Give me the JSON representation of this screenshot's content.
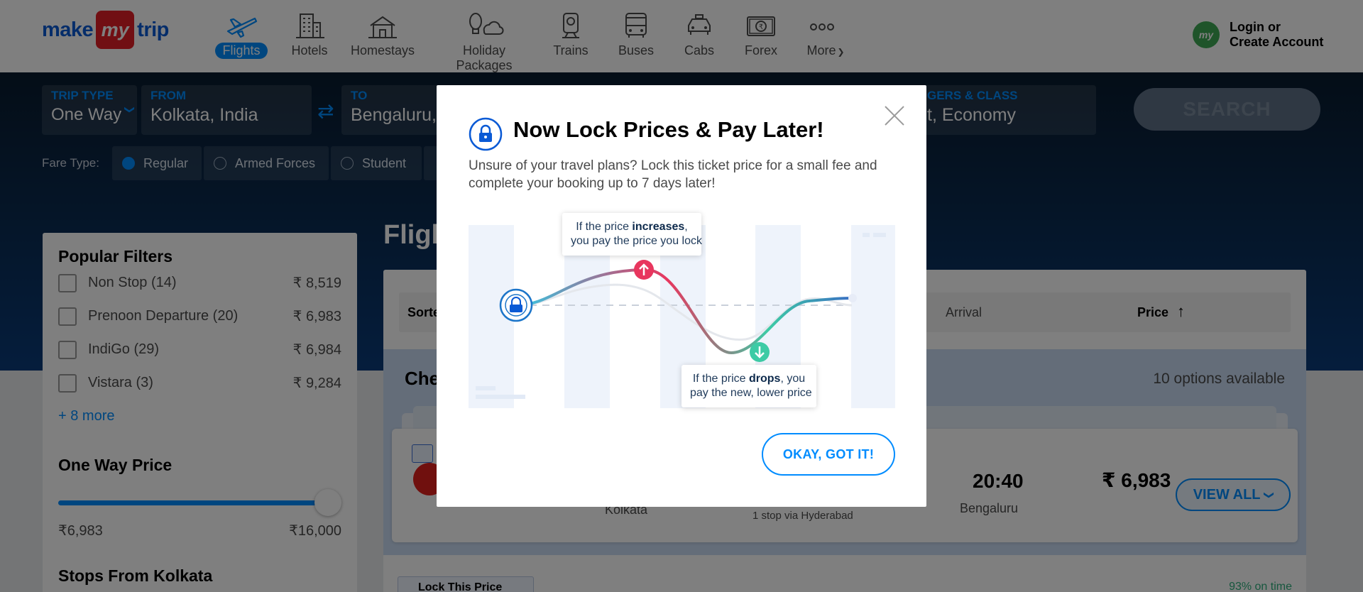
{
  "header": {
    "logo": {
      "part1": "make",
      "part2": "my",
      "part3": "trip"
    },
    "nav": [
      {
        "label": "Flights",
        "icon": "plane-icon",
        "active": true
      },
      {
        "label": "Hotels",
        "icon": "hotel-icon",
        "active": false
      },
      {
        "label": "Homestays",
        "icon": "homestay-icon",
        "active": false
      },
      {
        "label": "Holiday Packages",
        "icon": "holiday-icon",
        "active": false
      },
      {
        "label": "Trains",
        "icon": "train-icon",
        "active": false
      },
      {
        "label": "Buses",
        "icon": "bus-icon",
        "active": false
      },
      {
        "label": "Cabs",
        "icon": "cab-icon",
        "active": false
      },
      {
        "label": "Forex",
        "icon": "forex-icon",
        "active": false
      },
      {
        "label": "More",
        "icon": "more-icon",
        "active": false
      }
    ],
    "avatar_text": "my",
    "login_line1": "Login or",
    "login_line2": "Create Account"
  },
  "search": {
    "trip_type_label": "TRIP TYPE",
    "trip_type_value": "One Way",
    "from_label": "FROM",
    "from_value": "Kolkata, India",
    "to_label": "TO",
    "to_value": "Bengaluru,",
    "pax_label": "GERS & CLASS",
    "pax_value": "t, Economy",
    "search_label": "SEARCH",
    "fare_type_label": "Fare Type:",
    "fare_types": [
      "Regular",
      "Armed Forces",
      "Student"
    ]
  },
  "filters": {
    "popular_title": "Popular Filters",
    "items": [
      {
        "label": "Non Stop (14)",
        "price": "₹ 8,519"
      },
      {
        "label": "Prenoon Departure (20)",
        "price": "₹ 6,983"
      },
      {
        "label": "IndiGo (29)",
        "price": "₹ 6,984"
      },
      {
        "label": "Vistara (3)",
        "price": "₹ 9,284"
      }
    ],
    "more_label": "+ 8 more",
    "price_title": "One Way Price",
    "price_min": "₹6,983",
    "price_max": "₹16,000",
    "price_slider_fraction": 1.0,
    "stops_title": "Stops From Kolkata"
  },
  "results": {
    "flights_heading": "Fligh",
    "sort_label": "Sorte",
    "sort_arrival": "Arrival",
    "sort_price": "Price",
    "sort_arrow": "↑",
    "cheapest_heading": "Che",
    "options_count": "10 options available",
    "card": {
      "from_city": "Kolkata",
      "stops": "1 stop via Hyderabad",
      "arrival_time": "20:40",
      "to_city": "Bengaluru",
      "price": "₹ 6,983",
      "view_all": "VIEW ALL"
    },
    "lock_chip": "Lock This Price",
    "on_time": "93% on time"
  },
  "modal": {
    "title": "Now Lock Prices & Pay Later!",
    "description": "Unsure of your travel plans? Lock this ticket price for a small fee and complete your booking up to 7 days later!",
    "bubble_up_pre": "If the price ",
    "bubble_up_bold": "increases",
    "bubble_up_post": ",",
    "bubble_up_line2": "you pay the price you lock",
    "bubble_down_pre": "If the price ",
    "bubble_down_bold": "drops",
    "bubble_down_post": ", you",
    "bubble_down_line2": "pay the new, lower price",
    "ok_button": "OKAY, GOT IT!"
  },
  "colors": {
    "brand_blue": "#008cff",
    "brand_red": "#e21f26",
    "curve_up": "#e8365e",
    "curve_down": "#3dcba5"
  }
}
